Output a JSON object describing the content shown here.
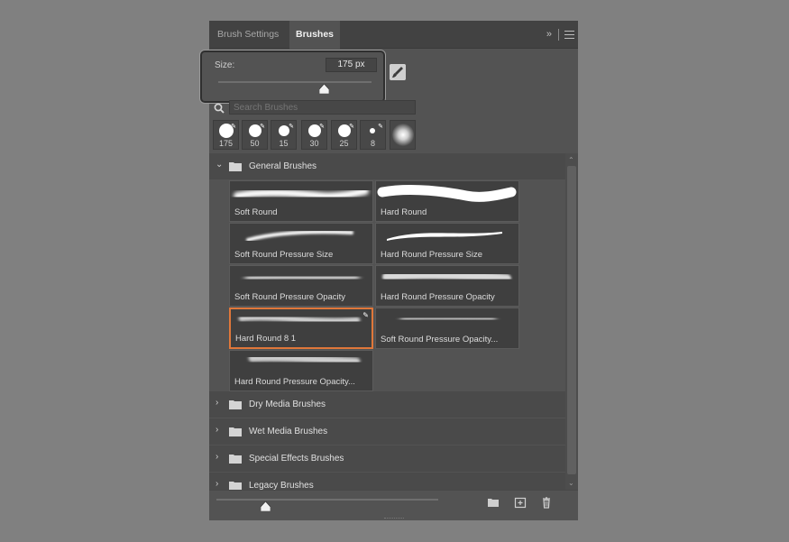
{
  "tabs": [
    {
      "label": "Brush Settings",
      "active": false
    },
    {
      "label": "Brushes",
      "active": true
    }
  ],
  "tab_controls": {
    "collapse_icon": "double-chevron-right-icon",
    "menu_icon": "hamburger-menu-icon"
  },
  "size": {
    "label": "Size:",
    "value": "175 px",
    "slider_fraction": 0.69
  },
  "search": {
    "placeholder": "Search Brushes"
  },
  "recent_brushes": [
    "175",
    "50",
    "15",
    "30",
    "25",
    "8",
    ""
  ],
  "groups": [
    {
      "name": "General Brushes",
      "expanded": true,
      "brushes": [
        {
          "label": "Soft Round",
          "selected": false
        },
        {
          "label": "Hard Round",
          "selected": false
        },
        {
          "label": "Soft Round Pressure Size",
          "selected": false
        },
        {
          "label": "Hard Round Pressure Size",
          "selected": false
        },
        {
          "label": "Soft Round Pressure Opacity",
          "selected": false
        },
        {
          "label": "Hard Round Pressure Opacity",
          "selected": false
        },
        {
          "label": "Hard Round 8 1",
          "selected": true
        },
        {
          "label": "Soft Round Pressure Opacity...",
          "selected": false
        },
        {
          "label": "Hard Round Pressure Opacity...",
          "selected": false
        }
      ]
    },
    {
      "name": "Dry Media Brushes",
      "expanded": false
    },
    {
      "name": "Wet Media Brushes",
      "expanded": false
    },
    {
      "name": "Special Effects Brushes",
      "expanded": false
    },
    {
      "name": "Legacy Brushes",
      "expanded": false
    }
  ],
  "preview_size_fraction": 0.22,
  "footer_icons": [
    "folder-icon",
    "plus-box-icon",
    "trash-icon"
  ],
  "colors": {
    "panel": "#535353",
    "selected_border": "#e0773a",
    "background": "#808080"
  }
}
